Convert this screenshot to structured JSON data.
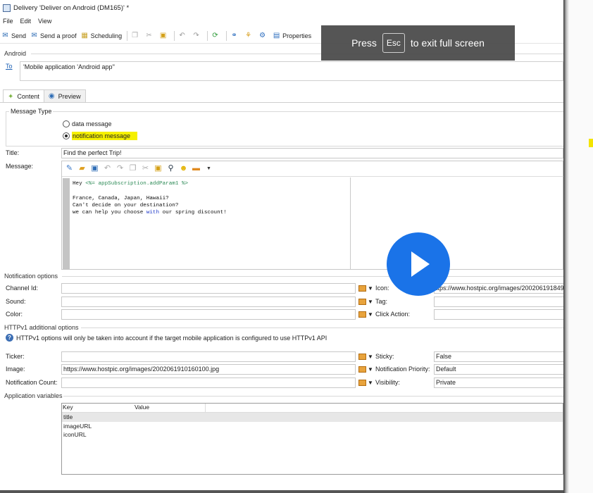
{
  "window": {
    "title": "Delivery 'Deliver on Android (DM165)' *"
  },
  "menu": {
    "file": "File",
    "edit": "Edit",
    "view": "View"
  },
  "toolbar": {
    "send": "Send",
    "send_proof": "Send a proof",
    "scheduling": "Scheduling",
    "properties": "Properties"
  },
  "android": {
    "group_label": "Android",
    "to_label": "To",
    "to_value": "'Mobile application 'Android app''"
  },
  "tabs": {
    "content": "Content",
    "preview": "Preview"
  },
  "message_type": {
    "legend": "Message Type",
    "option_data": "data message",
    "option_notification": "notification message",
    "selected": "notification message"
  },
  "title_field": {
    "label": "Title:",
    "value": "Find the perfect Trip!"
  },
  "message": {
    "label": "Message:",
    "line1_a": "Hey ",
    "line1_b": "<%= appSubscription.addParam1 %>",
    "line3": "France, Canada, Japan, Hawaii?",
    "line4": "Can't decide on your destination?",
    "line5_a": "we can help you choose ",
    "line5_b": "with",
    "line5_c": " our spring discount!"
  },
  "notification_options": {
    "heading": "Notification options",
    "channel_label": "Channel Id:",
    "sound_label": "Sound:",
    "color_label": "Color:",
    "icon_label": "Icon:",
    "icon_value": "ttps://www.hostpic.org/images/200206191849",
    "tag_label": "Tag:",
    "click_label": "Click Action:"
  },
  "httpv1": {
    "heading": "HTTPv1 additional options",
    "info": "HTTPv1 options will only be taken into account if the target mobile application is configured to use HTTPv1 API",
    "ticker_label": "Ticker:",
    "image_label": "Image:",
    "image_value": "https://www.hostpic.org/images/2002061910160100.jpg",
    "count_label": "Notification Count:",
    "sticky_label": "Sticky:",
    "sticky_value": "False",
    "priority_label": "Notification Priority:",
    "priority_value": "Default",
    "visibility_label": "Visibility:",
    "visibility_value": "Private"
  },
  "app_vars": {
    "heading": "Application variables",
    "col_key": "Key",
    "col_value": "Value",
    "rows": [
      "title",
      "imageURL",
      "iconURL"
    ]
  },
  "overlay": {
    "press": "Press",
    "key": "Esc",
    "rest": "to exit full screen"
  }
}
